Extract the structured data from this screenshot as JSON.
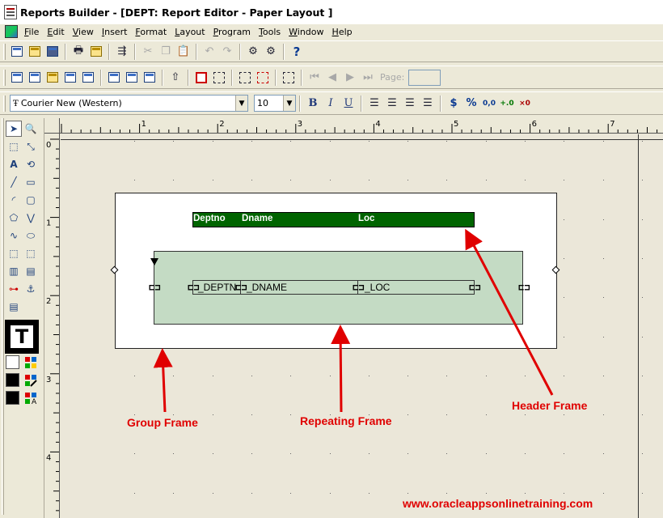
{
  "window": {
    "title": "Reports Builder - [DEPT: Report Editor - Paper Layout ]"
  },
  "menu": [
    "File",
    "Edit",
    "View",
    "Insert",
    "Format",
    "Layout",
    "Program",
    "Tools",
    "Window",
    "Help"
  ],
  "toolbar2": {
    "page_label": "Page:",
    "page_value": ""
  },
  "format_bar": {
    "font": "Courier New (Western)",
    "size": "10",
    "bold": "B",
    "italic": "I",
    "underline": "U",
    "currency": "$",
    "percent": "%",
    "decimal": "0,0",
    "add_decimal": "+.0",
    "remove_decimal": "×0"
  },
  "ruler": {
    "top_labels": [
      "1",
      "2",
      "3",
      "4",
      "5",
      "6",
      "7"
    ],
    "left_labels": [
      "0",
      "1",
      "2",
      "3",
      "4"
    ]
  },
  "layout": {
    "header_labels": [
      "Deptno",
      "Dname",
      "Loc"
    ],
    "field_labels": [
      "_DEPTN",
      "_DNAME",
      "_LOC"
    ]
  },
  "callouts": {
    "group_frame": "Group Frame",
    "repeating_frame": "Repeating Frame",
    "header_frame": "Header Frame",
    "website": "www.oracleappsonlinetraining.com"
  },
  "colors": {
    "header_frame": "#006400",
    "repeating_frame": "#c4dbc4",
    "callout": "#e00000"
  }
}
